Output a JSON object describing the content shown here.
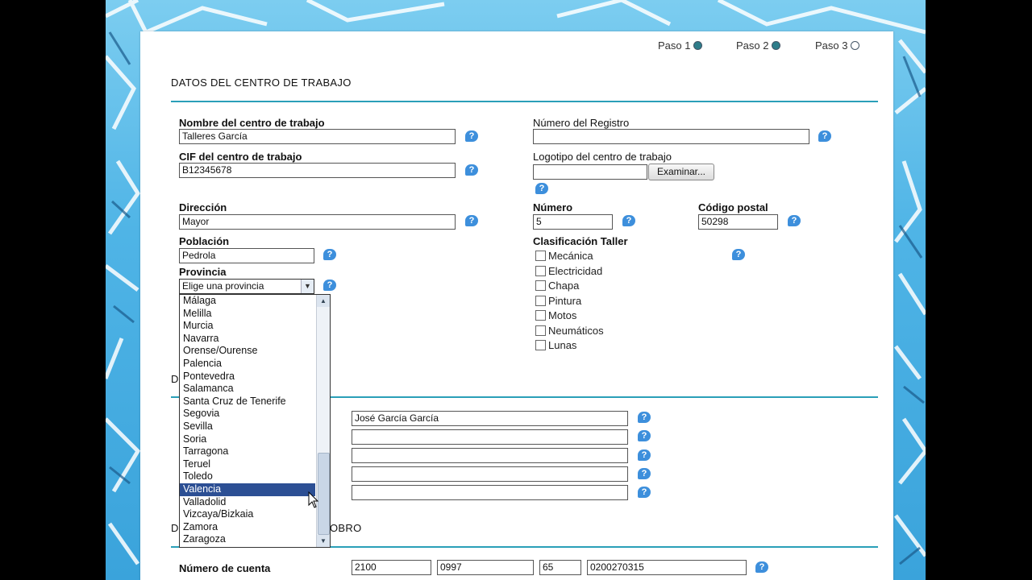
{
  "steps": [
    {
      "label": "Paso 1",
      "state": "done"
    },
    {
      "label": "Paso 2",
      "state": "current"
    },
    {
      "label": "Paso 3",
      "state": "pending"
    }
  ],
  "section1": {
    "title": "DATOS DEL CENTRO DE TRABAJO",
    "nombre": {
      "label": "Nombre del centro de trabajo",
      "value": "Talleres García"
    },
    "cif": {
      "label": "CIF del centro de trabajo",
      "value": "B12345678"
    },
    "registro": {
      "label": "Número del Registro",
      "value": ""
    },
    "logotipo": {
      "label": "Logotipo del centro de trabajo",
      "value": "",
      "button": "Examinar..."
    },
    "direccion": {
      "label": "Dirección",
      "value": "Mayor"
    },
    "numero": {
      "label": "Número",
      "value": "5"
    },
    "cp": {
      "label": "Código postal",
      "value": "50298"
    },
    "poblacion": {
      "label": "Población",
      "value": "Pedrola"
    },
    "provincia": {
      "label": "Provincia",
      "value": "Elige una provincia"
    },
    "clasificacion": {
      "label": "Clasificación Taller",
      "options": [
        "Mecánica",
        "Electricidad",
        "Chapa",
        "Pintura",
        "Motos",
        "Neumáticos",
        "Lunas"
      ]
    }
  },
  "provincia_dropdown": {
    "items": [
      "Málaga",
      "Melilla",
      "Murcia",
      "Navarra",
      "Orense/Ourense",
      "Palencia",
      "Pontevedra",
      "Salamanca",
      "Santa Cruz de Tenerife",
      "Segovia",
      "Sevilla",
      "Soria",
      "Tarragona",
      "Teruel",
      "Toledo",
      "Valencia",
      "Valladolid",
      "Vizcaya/Bizkaia",
      "Zamora",
      "Zaragoza"
    ],
    "selected": "Valencia"
  },
  "section2": {
    "title_fragment": "D",
    "fields": [
      "José García García",
      "",
      "",
      "",
      ""
    ]
  },
  "section3": {
    "title_fragment_left": "D",
    "title_fragment_right": "OBRO",
    "cuenta": {
      "label": "Número de cuenta",
      "entidad": "2100",
      "oficina": "0997",
      "dc": "65",
      "numero": "0200270315"
    }
  },
  "icons": {
    "help": "help-bubble-icon"
  },
  "colors": {
    "accent_rule": "#2a9fb8",
    "help_icon": "#3d8fdc",
    "selected_item": "#2c4f94"
  }
}
